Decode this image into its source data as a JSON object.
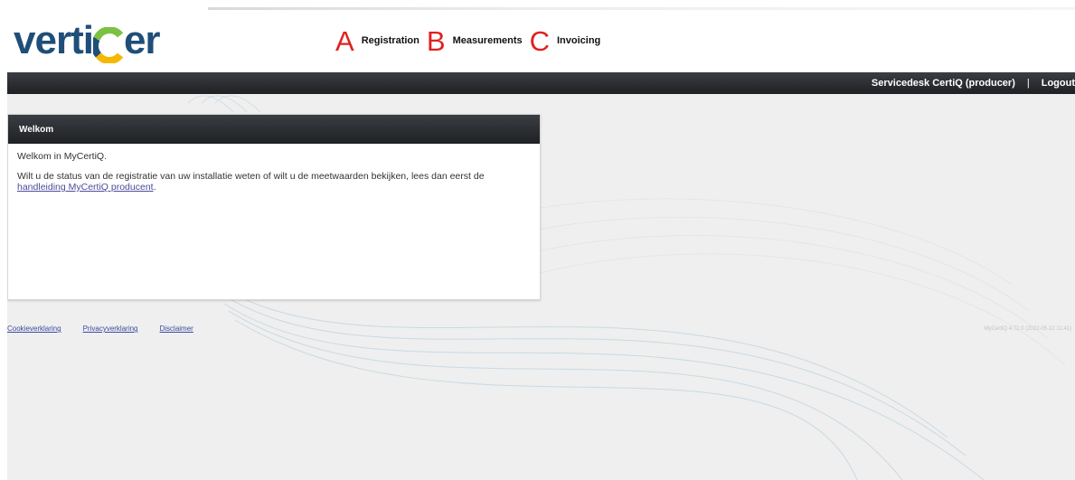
{
  "brand": {
    "logo_prefix": "verti",
    "logo_suffix": "er",
    "logo_text": "vertiCer",
    "colors": {
      "blue": "#1f4e79",
      "green": "#7cc242",
      "yellow": "#f5b800",
      "red": "#e02020",
      "dark_bar": "#26282c"
    }
  },
  "topnav": {
    "items": [
      {
        "marker": "A",
        "label": "Registration"
      },
      {
        "marker": "B",
        "label": "Measurements"
      },
      {
        "marker": "C",
        "label": "Invoicing"
      }
    ]
  },
  "header_bar": {
    "user_label": "Servicedesk CertiQ (producer)",
    "separator": "|",
    "logout_label": "Logout"
  },
  "panel": {
    "title": "Welkom",
    "greeting": "Welkom in MyCertiQ.",
    "instruction": "Wilt u de status van de registratie van uw installatie weten of wilt u de meetwaarden bekijken, lees dan eerst de ",
    "link_text": "handleiding MyCertiQ producent",
    "link_suffix": "."
  },
  "footer": {
    "links": [
      "Cookieverklaring",
      "Privacyverklaring",
      "Disclaimer"
    ],
    "version": "MyCertiQ 4.72.0 (2022-05-12 11:41)"
  }
}
